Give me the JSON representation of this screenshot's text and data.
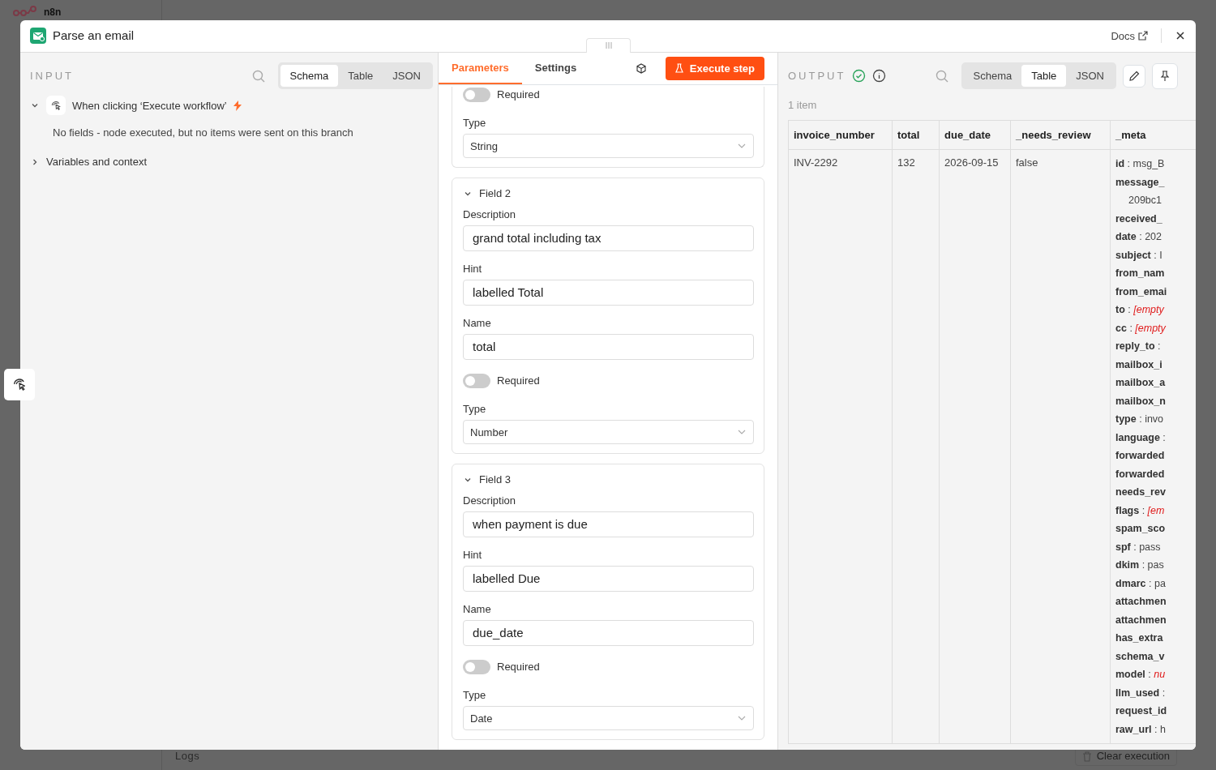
{
  "background": {
    "logo": "n8n",
    "logs_label": "Logs",
    "clear_button": "Clear execution"
  },
  "window": {
    "title": "Parse an email",
    "docs_link": "Docs"
  },
  "input": {
    "heading": "INPUT",
    "views": [
      {
        "label": "Schema",
        "selected": true
      },
      {
        "label": "Table",
        "selected": false
      },
      {
        "label": "JSON",
        "selected": false
      }
    ],
    "trigger": {
      "label": "When clicking ‘Execute workflow’",
      "expanded": true,
      "message": "No fields - node executed, but no items were sent on this branch"
    },
    "variables": {
      "label": "Variables and context",
      "expanded": false
    }
  },
  "parameters": {
    "tabs": [
      {
        "label": "Parameters",
        "selected": true
      },
      {
        "label": "Settings",
        "selected": false
      }
    ],
    "execute_button": "Execute step",
    "fields": [
      {
        "required": false,
        "required_label": "Required",
        "type_label": "Type",
        "type": "String"
      },
      {
        "title": "Field 2",
        "expanded": true,
        "description_label": "Description",
        "description": "grand total including tax",
        "hint": {
          "label": "Hint",
          "value": "labelled Total"
        },
        "name_label": "Name",
        "name": "total",
        "required": false,
        "required_label": "Required",
        "type_label": "Type",
        "type": "Number"
      },
      {
        "title": "Field 3",
        "expanded": true,
        "description_label": "Description",
        "description": "when payment is due",
        "hint": {
          "label": "Hint",
          "value": "labelled Due"
        },
        "name_label": "Name",
        "name": "due_date",
        "required": false,
        "required_label": "Required",
        "type_label": "Type",
        "type": "Date"
      }
    ]
  },
  "output": {
    "heading": "OUTPUT",
    "succeeded": true,
    "count": "1 item",
    "views": [
      {
        "label": "Schema",
        "selected": false
      },
      {
        "label": "Table",
        "selected": true
      },
      {
        "label": "JSON",
        "selected": false
      }
    ],
    "table": {
      "columns": [
        "invoice_number",
        "total",
        "due_date",
        "_needs_review",
        "_meta"
      ],
      "rows": [
        {
          "cells": [
            "INV-2292",
            "132",
            "2026-09-15",
            "false"
          ],
          "meta": [
            {
              "key": "id",
              "sep": ":",
              "value": "msg_B",
              "kind": "text"
            },
            {
              "key": "message_",
              "value": "209bc1",
              "kind": "wrapped"
            },
            {
              "key": "received_"
            },
            {
              "key": "date",
              "sep": ":",
              "value": "202",
              "kind": "text"
            },
            {
              "key": "subject",
              "sep": ":",
              "value": "I",
              "kind": "text"
            },
            {
              "key": "from_nam"
            },
            {
              "key": "from_emai"
            },
            {
              "key": "to",
              "sep": ":",
              "value": "[empty",
              "kind": "missing"
            },
            {
              "key": "cc",
              "sep": ":",
              "value": "[empty",
              "kind": "missing"
            },
            {
              "key": "reply_to",
              "sep": ":"
            },
            {
              "key": "mailbox_i"
            },
            {
              "key": "mailbox_a"
            },
            {
              "key": "mailbox_n"
            },
            {
              "key": "type",
              "sep": ":",
              "value": "invo",
              "kind": "text"
            },
            {
              "key": "language",
              "sep": ":"
            },
            {
              "key": "forwarded"
            },
            {
              "key": "forwarded"
            },
            {
              "key": "needs_rev"
            },
            {
              "key": "flags",
              "sep": ":",
              "value": "[em",
              "kind": "missing"
            },
            {
              "key": "spam_sco"
            },
            {
              "key": "spf",
              "sep": ":",
              "value": "pass",
              "kind": "text"
            },
            {
              "key": "dkim",
              "sep": ":",
              "value": "pas",
              "kind": "text"
            },
            {
              "key": "dmarc",
              "sep": ":",
              "value": "pa",
              "kind": "text"
            },
            {
              "key": "attachmen"
            },
            {
              "key": "attachmen"
            },
            {
              "key": "has_extra"
            },
            {
              "key": "schema_v"
            },
            {
              "key": "model",
              "sep": ":",
              "value": "nu",
              "kind": "missing"
            },
            {
              "key": "llm_used",
              "sep": ":"
            },
            {
              "key": "request_id"
            },
            {
              "key": "raw_url",
              "sep": ":",
              "value": "h",
              "kind": "text"
            }
          ]
        }
      ]
    }
  }
}
